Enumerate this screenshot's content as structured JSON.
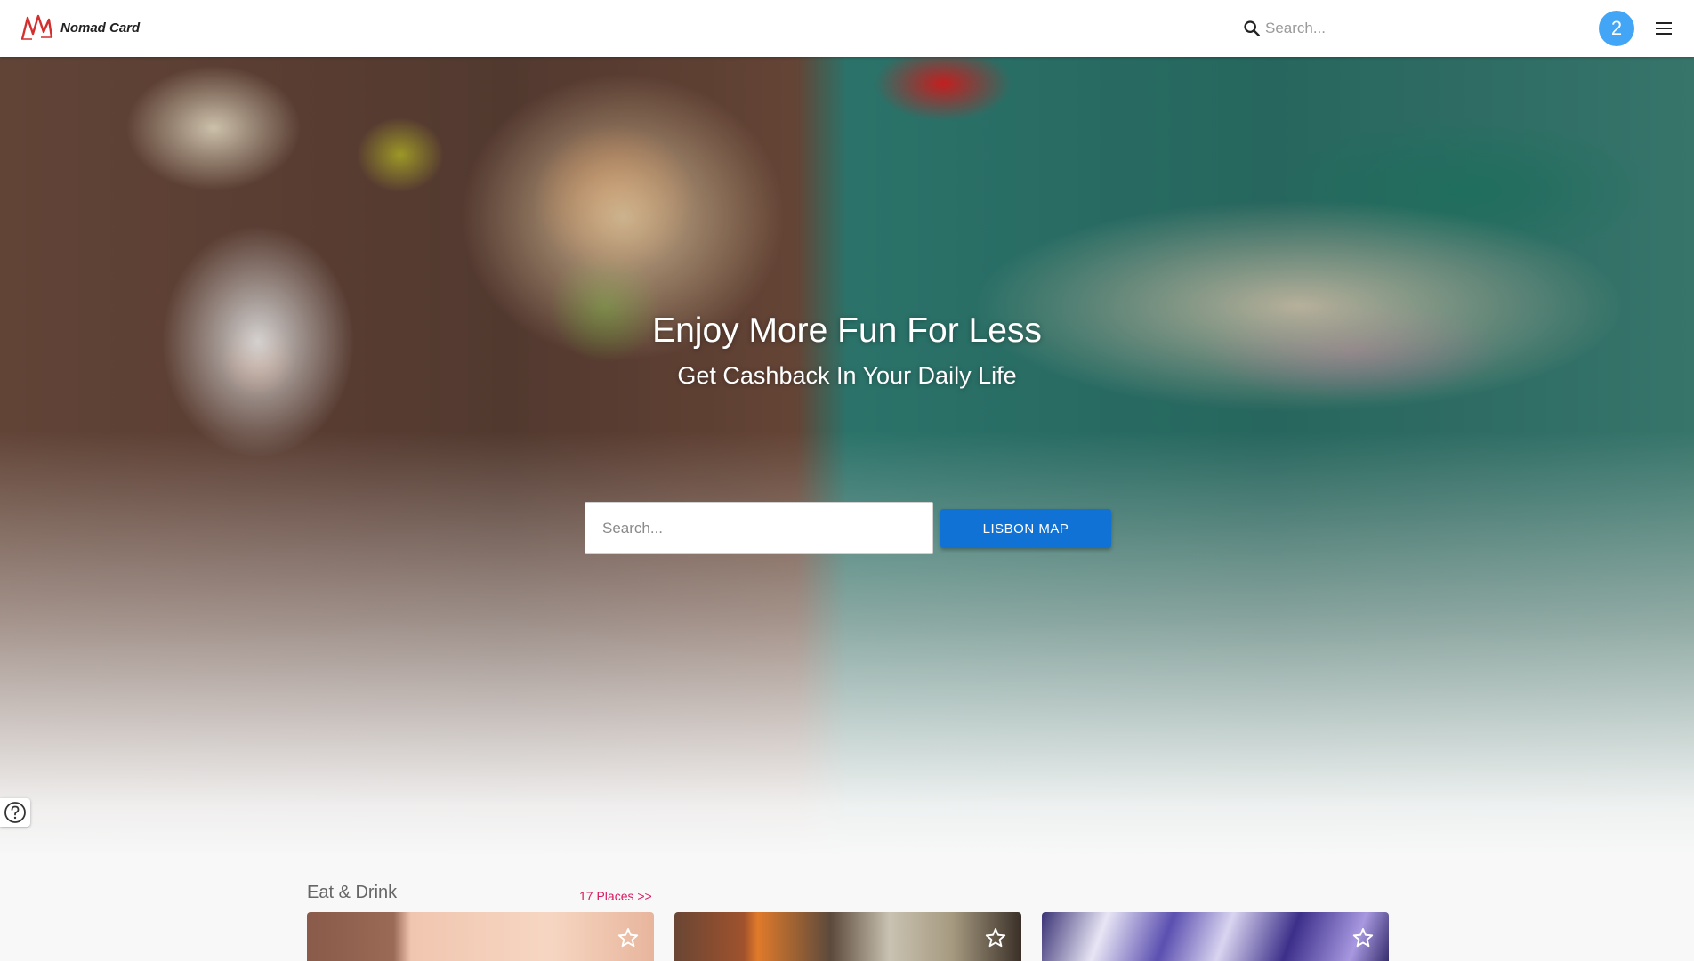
{
  "brand": {
    "name": "Nomad Card",
    "logo_icon": "nomad-card-logo"
  },
  "header": {
    "search_placeholder": "Search...",
    "search_icon": "search-icon",
    "notification_count": "2",
    "menu_icon": "hamburger-menu-icon"
  },
  "hero": {
    "title": "Enjoy More Fun For Less",
    "subtitle": "Get Cashback In Your Daily Life",
    "search_placeholder": "Search...",
    "map_button_label": "LISBON MAP"
  },
  "help": {
    "icon": "help-icon"
  },
  "section": {
    "title": "Eat & Drink",
    "link_label": "17 Places >>",
    "cards": [
      {
        "favorite_icon": "star-outline-icon"
      },
      {
        "favorite_icon": "star-outline-icon"
      },
      {
        "favorite_icon": "star-outline-icon"
      }
    ]
  },
  "colors": {
    "accent_button": "#1172d6",
    "badge": "#42a5f5",
    "link": "#d81b60",
    "logo": "#d32f2f"
  }
}
